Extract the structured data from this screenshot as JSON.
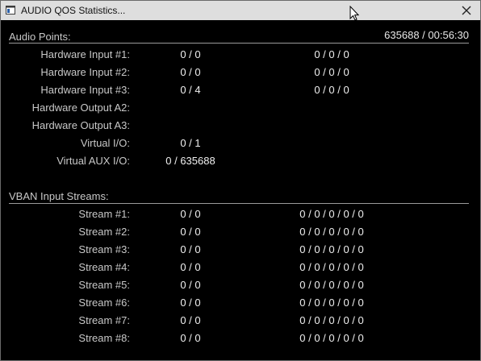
{
  "window": {
    "title": "AUDIO QOS Statistics...",
    "close_icon": "close-icon"
  },
  "status": "635688 / 00:56:30",
  "audio_points": {
    "title": "Audio Points:",
    "rows": [
      {
        "label": "Hardware Input #1:",
        "v1": "0 / 0",
        "v2": "0 / 0 / 0"
      },
      {
        "label": "Hardware Input #2:",
        "v1": "0 / 0",
        "v2": "0 / 0 / 0"
      },
      {
        "label": "Hardware Input #3:",
        "v1": "0 / 4",
        "v2": "0 / 0 / 0"
      },
      {
        "label": "Hardware Output A2:",
        "v1": "",
        "v2": ""
      },
      {
        "label": "Hardware Output A3:",
        "v1": "",
        "v2": ""
      },
      {
        "label": "Virtual I/O:",
        "v1": "0 / 1",
        "v2": ""
      },
      {
        "label": "Virtual AUX I/O:",
        "v1": "0 / 635688",
        "v2": ""
      }
    ]
  },
  "vban_streams": {
    "title": "VBAN Input Streams:",
    "rows": [
      {
        "label": "Stream #1:",
        "v1": "0 / 0",
        "v2": "0 / 0 / 0 / 0 / 0"
      },
      {
        "label": "Stream #2:",
        "v1": "0 / 0",
        "v2": "0 / 0 / 0 / 0 / 0"
      },
      {
        "label": "Stream #3:",
        "v1": "0 / 0",
        "v2": "0 / 0 / 0 / 0 / 0"
      },
      {
        "label": "Stream #4:",
        "v1": "0 / 0",
        "v2": "0 / 0 / 0 / 0 / 0"
      },
      {
        "label": "Stream #5:",
        "v1": "0 / 0",
        "v2": "0 / 0 / 0 / 0 / 0"
      },
      {
        "label": "Stream #6:",
        "v1": "0 / 0",
        "v2": "0 / 0 / 0 / 0 / 0"
      },
      {
        "label": "Stream #7:",
        "v1": "0 / 0",
        "v2": "0 / 0 / 0 / 0 / 0"
      },
      {
        "label": "Stream #8:",
        "v1": "0 / 0",
        "v2": "0 / 0 / 0 / 0 / 0"
      }
    ]
  }
}
